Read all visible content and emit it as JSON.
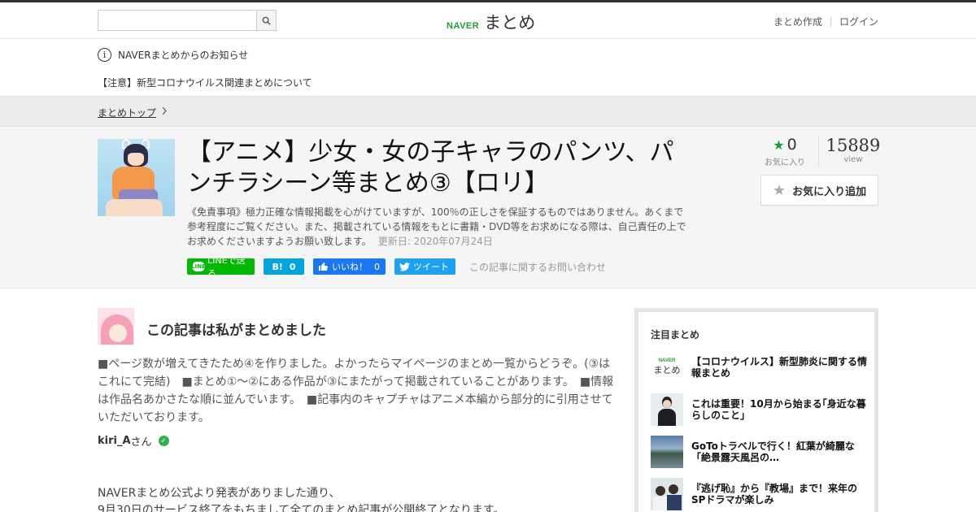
{
  "header": {
    "logo_naver": "NAVER",
    "logo_matome": "まとめ",
    "links": [
      "まとめ作成",
      "ログイン"
    ],
    "search_placeholder": ""
  },
  "notice": {
    "title": "NAVERまとめからのお知らせ",
    "link": "【注意】新型コロナウイルス関連まとめについて"
  },
  "breadcrumb": {
    "label": "まとめトップ"
  },
  "article": {
    "title": "【アニメ】少女・女の子キャラのパンツ、パンチラシーン等まとめ③【ロリ】",
    "disclaimer": "《免責事項》極力正確な情報掲載を心がけていますが、100％の正しさを保証するものではありません。あくまで参考程度にご覧ください。また、掲載されている情報をもとに書籍・DVD等をお求めになる際は、自己責任の上でお求めくださいますようお願い致します。",
    "updated": "更新日: 2020年07月24日",
    "favorites": "0",
    "favorites_label": "お気に入り",
    "views": "15889",
    "views_label": "view",
    "fav_button": "お気に入り追加"
  },
  "share": {
    "line": "LINEで送る",
    "line_icon": "LINE",
    "hatena": "B!",
    "hatena_count": "0",
    "facebook": "いいね！",
    "facebook_count": "0",
    "twitter": "ツイート",
    "inquiry": "この記事に関するお問い合わせ"
  },
  "author": {
    "heading": "この記事は私がまとめました",
    "summary": "■ページ数が増えてきたため④を作りました。よかったらマイページのまとめ一覧からどうぞ。(③はこれにて完結)　■まとめ①～②にある作品が③にまたがって掲載されていることがあります。　■情報は作品名あかさたな順に並んでいます。　■記事内のキャプチャはアニメ本編から部分的に引用させていただいております。",
    "username": "kiri_A",
    "suffix": "さん"
  },
  "body": {
    "line1": "NAVERまとめ公式より発表がありました通り、",
    "line2": "9月30日のサービス終了をもちまして全てのまとめ記事が公開終了となります。"
  },
  "sidebar": {
    "title": "注目まとめ",
    "items": [
      {
        "text": "【コロナウイルス】新型肺炎に関する情報まとめ",
        "thumb_naver": "NAVER",
        "thumb_matome": "まとめ"
      },
      {
        "text": "これは重要！10月から始まる｢身近な暮らしのこと｣"
      },
      {
        "text": "GoToトラベルで行く！紅葉が綺麗な「絶景露天風呂の…"
      },
      {
        "text": "『逃げ恥』から『教場』まで！来年のSPドラマが楽しみ"
      }
    ]
  },
  "colors": {
    "naver_green": "#1aa031",
    "line_green": "#00b900",
    "hatena_blue": "#00a4de",
    "facebook_blue": "#1877f2",
    "twitter_blue": "#1da1f2"
  }
}
